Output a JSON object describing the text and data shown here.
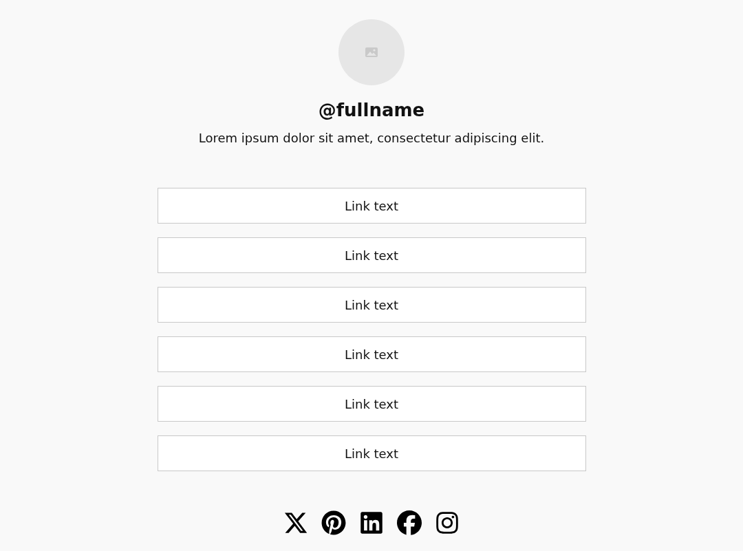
{
  "profile": {
    "name": "@fullname",
    "bio": "Lorem ipsum dolor sit amet, consectetur adipiscing elit."
  },
  "links": [
    {
      "label": "Link text"
    },
    {
      "label": "Link text"
    },
    {
      "label": "Link text"
    },
    {
      "label": "Link text"
    },
    {
      "label": "Link text"
    },
    {
      "label": "Link text"
    }
  ],
  "social": [
    {
      "kind": "x"
    },
    {
      "kind": "pinterest"
    },
    {
      "kind": "linkedin"
    },
    {
      "kind": "facebook"
    },
    {
      "kind": "instagram"
    }
  ]
}
